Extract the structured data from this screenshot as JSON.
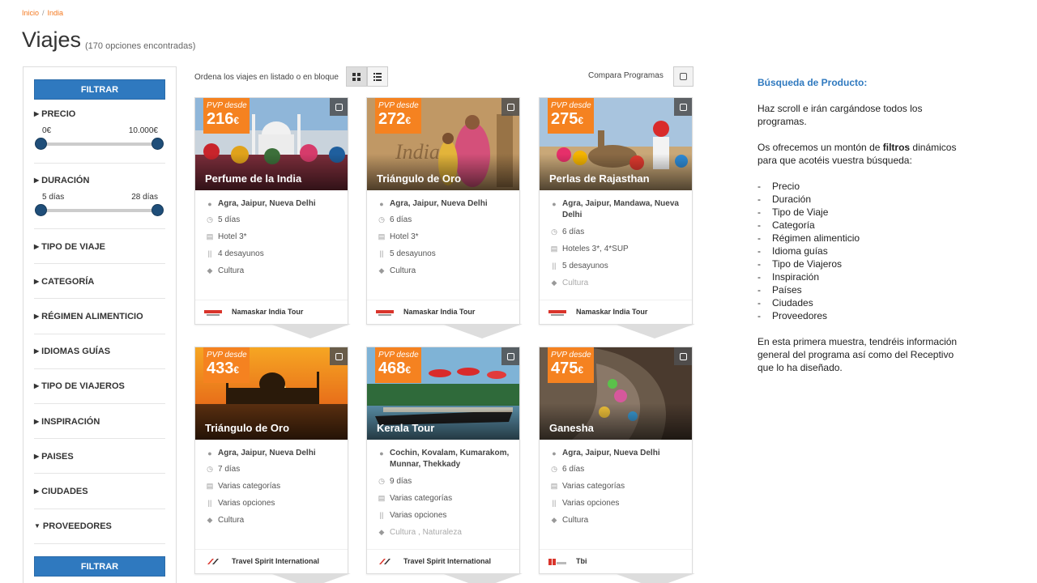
{
  "breadcrumb": {
    "home": "Inicio",
    "separator": "/",
    "current": "India"
  },
  "page": {
    "title": "Viajes",
    "count": "(170 opciones encontradas)"
  },
  "sidebar": {
    "filter_label": "FILTRAR",
    "price": {
      "label": "PRECIO",
      "min": "0€",
      "max": "10.000€"
    },
    "duration": {
      "label": "DURACIÓN",
      "min": "5 días",
      "max": "28 días"
    },
    "sections": [
      "TIPO DE VIAJE",
      "CATEGORÍA",
      "RÉGIMEN ALIMENTICIO",
      "IDIOMAS GUÍAS",
      "TIPO DE VIAJEROS",
      "INSPIRACIÓN",
      "PAISES",
      "CIUDADES",
      "PROVEEDORES"
    ]
  },
  "toolbar": {
    "sort_label": "Ordena los viajes en listado o en bloque",
    "compare_label": "Compara Programas"
  },
  "cards": [
    {
      "pvp": "PVP desde",
      "price": "216",
      "currency": "€",
      "title": "Perfume de la India",
      "places": "Agra, Jaipur, Nueva Delhi",
      "days": "5 días",
      "hotel": "Hotel 3*",
      "meals": "4 desayunos",
      "type": "Cultura",
      "provider": "Namaskar India Tour"
    },
    {
      "pvp": "PVP desde",
      "price": "272",
      "currency": "€",
      "title": "Triángulo de Oro",
      "places": "Agra, Jaipur, Nueva Delhi",
      "days": "6 días",
      "hotel": "Hotel 3*",
      "meals": "5 desayunos",
      "type": "Cultura",
      "provider": "Namaskar India Tour"
    },
    {
      "pvp": "PVP desde",
      "price": "275",
      "currency": "€",
      "title": "Perlas de Rajasthan",
      "places": "Agra, Jaipur, Mandawa, Nueva Delhi",
      "days": "6 días",
      "hotel": "Hoteles 3*, 4*SUP",
      "meals": "5 desayunos",
      "type": "Cultura",
      "provider": "Namaskar India Tour"
    },
    {
      "pvp": "PVP desde",
      "price": "433",
      "currency": "€",
      "title": "Triángulo de Oro",
      "places": "Agra, Jaipur, Nueva Delhi",
      "days": "7 días",
      "hotel": "Varias categorías",
      "meals": "Varias opciones",
      "type": "Cultura",
      "provider": "Travel Spirit International"
    },
    {
      "pvp": "PVP desde",
      "price": "468",
      "currency": "€",
      "title": "Kerala Tour",
      "places": "Cochin, Kovalam, Kumarakom, Munnar, Thekkady",
      "days": "9 días",
      "hotel": "Varias categorías",
      "meals": "Varias opciones",
      "type": "Cultura , Naturaleza",
      "provider": "Travel Spirit International"
    },
    {
      "pvp": "PVP desde",
      "price": "475",
      "currency": "€",
      "title": "Ganesha",
      "places": "Agra, Jaipur, Nueva Delhi",
      "days": "6 días",
      "hotel": "Varias categorías",
      "meals": "Varias opciones",
      "type": "Cultura",
      "provider": "Tbi"
    }
  ],
  "notes": {
    "heading": "Búsqueda de Producto:",
    "p1": "Haz scroll e irán cargándose todos los programas.",
    "p2_before": "Os ofrecemos un montón de ",
    "p2_bold": "filtros",
    "p2_after": " dinámicos para que acotéis vuestra búsqueda:",
    "list": [
      "Precio",
      "Duración",
      "Tipo de Viaje",
      "Categoría",
      "Régimen alimenticio",
      "Idioma guías",
      "Tipo de Viajeros",
      "Inspiración",
      "Países",
      "Ciudades",
      "Proveedores"
    ],
    "p3": "En esta primera muestra, tendréis información general del programa así como del Receptivo que lo ha diseñado."
  },
  "colors": {
    "accent": "#f58220",
    "primary": "#2f79bf",
    "slider_handle": "#1f4e79"
  }
}
